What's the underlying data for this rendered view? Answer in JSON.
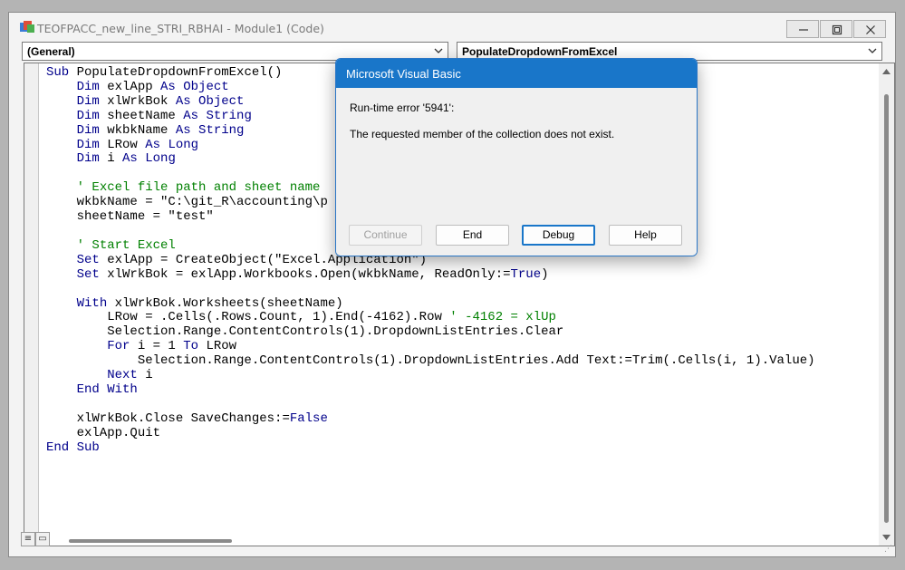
{
  "window": {
    "title": "TEOFPACC_new_line_STRI_RBHAI - Module1 (Code)"
  },
  "object_combo": {
    "value": "(General)"
  },
  "proc_combo": {
    "value": "PopulateDropdownFromExcel"
  },
  "code_lines": [
    [
      {
        "t": "Sub ",
        "c": "kw"
      },
      {
        "t": "PopulateDropdownFromExcel()"
      }
    ],
    [
      {
        "t": "    "
      },
      {
        "t": "Dim ",
        "c": "kw"
      },
      {
        "t": "exlApp "
      },
      {
        "t": "As Object",
        "c": "kw"
      }
    ],
    [
      {
        "t": "    "
      },
      {
        "t": "Dim ",
        "c": "kw"
      },
      {
        "t": "xlWrkBok "
      },
      {
        "t": "As Object",
        "c": "kw"
      }
    ],
    [
      {
        "t": "    "
      },
      {
        "t": "Dim ",
        "c": "kw"
      },
      {
        "t": "sheetName "
      },
      {
        "t": "As String",
        "c": "kw"
      }
    ],
    [
      {
        "t": "    "
      },
      {
        "t": "Dim ",
        "c": "kw"
      },
      {
        "t": "wkbkName "
      },
      {
        "t": "As String",
        "c": "kw"
      }
    ],
    [
      {
        "t": "    "
      },
      {
        "t": "Dim ",
        "c": "kw"
      },
      {
        "t": "LRow "
      },
      {
        "t": "As Long",
        "c": "kw"
      }
    ],
    [
      {
        "t": "    "
      },
      {
        "t": "Dim ",
        "c": "kw"
      },
      {
        "t": "i "
      },
      {
        "t": "As Long",
        "c": "kw"
      }
    ],
    [
      {
        "t": ""
      }
    ],
    [
      {
        "t": "    "
      },
      {
        "t": "' Excel file path and sheet name",
        "c": "cm"
      }
    ],
    [
      {
        "t": "    wkbkName = \"C:\\git_R\\accounting\\p"
      }
    ],
    [
      {
        "t": "    sheetName = \"test\""
      }
    ],
    [
      {
        "t": ""
      }
    ],
    [
      {
        "t": "    "
      },
      {
        "t": "' Start Excel",
        "c": "cm"
      }
    ],
    [
      {
        "t": "    "
      },
      {
        "t": "Set ",
        "c": "kw"
      },
      {
        "t": "exlApp = CreateObject(\"Excel.Application\")"
      }
    ],
    [
      {
        "t": "    "
      },
      {
        "t": "Set ",
        "c": "kw"
      },
      {
        "t": "xlWrkBok = exlApp.Workbooks.Open(wkbkName, ReadOnly:="
      },
      {
        "t": "True",
        "c": "kw"
      },
      {
        "t": ")"
      }
    ],
    [
      {
        "t": ""
      }
    ],
    [
      {
        "t": "    "
      },
      {
        "t": "With ",
        "c": "kw"
      },
      {
        "t": "xlWrkBok.Worksheets(sheetName)"
      }
    ],
    [
      {
        "t": "        LRow = .Cells(.Rows.Count, 1).End(-4162).Row "
      },
      {
        "t": "' -4162 = xlUp",
        "c": "cm"
      }
    ],
    [
      {
        "t": "        Selection.Range.ContentControls(1).DropdownListEntries.Clear"
      }
    ],
    [
      {
        "t": "        "
      },
      {
        "t": "For ",
        "c": "kw"
      },
      {
        "t": "i = 1 "
      },
      {
        "t": "To ",
        "c": "kw"
      },
      {
        "t": "LRow"
      }
    ],
    [
      {
        "t": "            Selection.Range.ContentControls(1).DropdownListEntries.Add Text:=Trim(.Cells(i, 1).Value)"
      }
    ],
    [
      {
        "t": "        "
      },
      {
        "t": "Next ",
        "c": "kw"
      },
      {
        "t": "i"
      }
    ],
    [
      {
        "t": "    "
      },
      {
        "t": "End With",
        "c": "kw"
      }
    ],
    [
      {
        "t": ""
      }
    ],
    [
      {
        "t": "    xlWrkBok.Close SaveChanges:="
      },
      {
        "t": "False",
        "c": "kw"
      }
    ],
    [
      {
        "t": "    exlApp.Quit"
      }
    ],
    [
      {
        "t": "End Sub",
        "c": "kw"
      }
    ]
  ],
  "dialog": {
    "title": "Microsoft Visual Basic",
    "error_line": "Run-time error '5941':",
    "message": "The requested member of the collection does not exist.",
    "buttons": {
      "continue": "Continue",
      "end": "End",
      "debug": "Debug",
      "help": "Help"
    }
  },
  "colors": {
    "keyword": "#00008b",
    "comment": "#008000",
    "dialog_title_bg": "#1976c9"
  },
  "icons": {
    "app": "vba-module-icon",
    "minimize": "minimize-icon",
    "restore": "restore-icon",
    "close": "close-icon",
    "dropdown": "chevron-down-icon"
  }
}
